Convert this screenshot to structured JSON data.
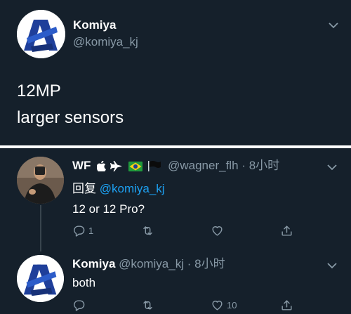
{
  "main_tweet": {
    "author_name": "Komiya",
    "author_handle": "@komiya_kj",
    "avatar_icon": "komiya-logo-icon",
    "text_lines": [
      "12MP",
      "larger sensors"
    ]
  },
  "replies": [
    {
      "author_name": "WF",
      "author_badges": [
        "apple-icon",
        "airplane-icon",
        "brazil-flag-icon",
        "black-flag-icon"
      ],
      "author_handle": "@wagner_flh",
      "separator": "·",
      "time": "8小时",
      "reply_prefix": "回复",
      "reply_mention": "@komiya_kj",
      "text": "12 or 12 Pro?",
      "actions": {
        "reply_count": "1",
        "retweet_count": "",
        "like_count": ""
      }
    },
    {
      "author_name": "Komiya",
      "author_handle": "@komiya_kj",
      "separator": "·",
      "time": "8小时",
      "text": "both",
      "actions": {
        "reply_count": "",
        "retweet_count": "",
        "like_count": "10"
      }
    }
  ],
  "colors": {
    "background": "#15202b",
    "secondary_text": "#8899a6",
    "link": "#1da1f2",
    "divider": "#ffffff"
  }
}
